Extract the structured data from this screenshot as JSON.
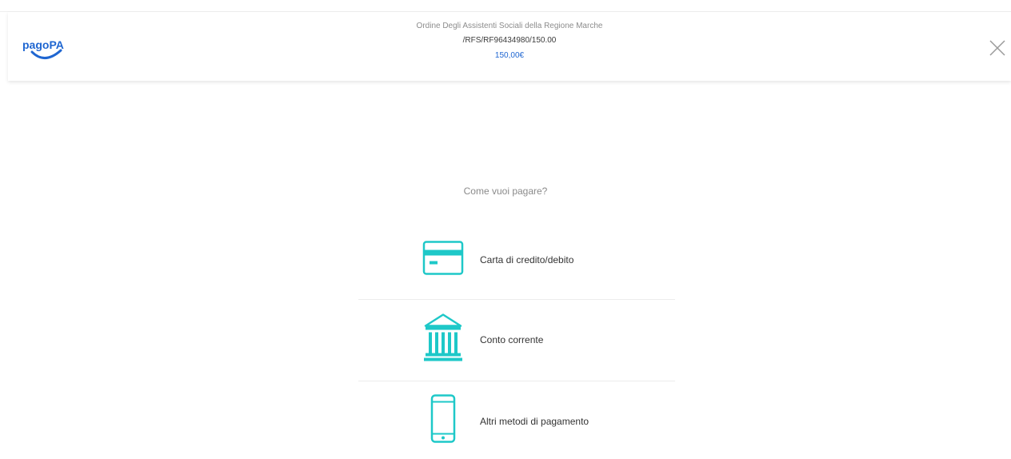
{
  "header": {
    "creditor": "Ordine Degli Assistenti Sociali della Regione Marche",
    "reference": "/RFS/RF96434980/150.00",
    "amount": "150,00€"
  },
  "colors": {
    "brand_blue": "#1f66d1",
    "accent_teal": "#1ec8c8"
  },
  "payment": {
    "question": "Come vuoi pagare?",
    "methods": [
      {
        "label": "Carta di credito/debito",
        "icon": "credit-card-icon"
      },
      {
        "label": "Conto corrente",
        "icon": "bank-icon"
      },
      {
        "label": "Altri metodi di pagamento",
        "icon": "smartphone-icon"
      }
    ]
  }
}
